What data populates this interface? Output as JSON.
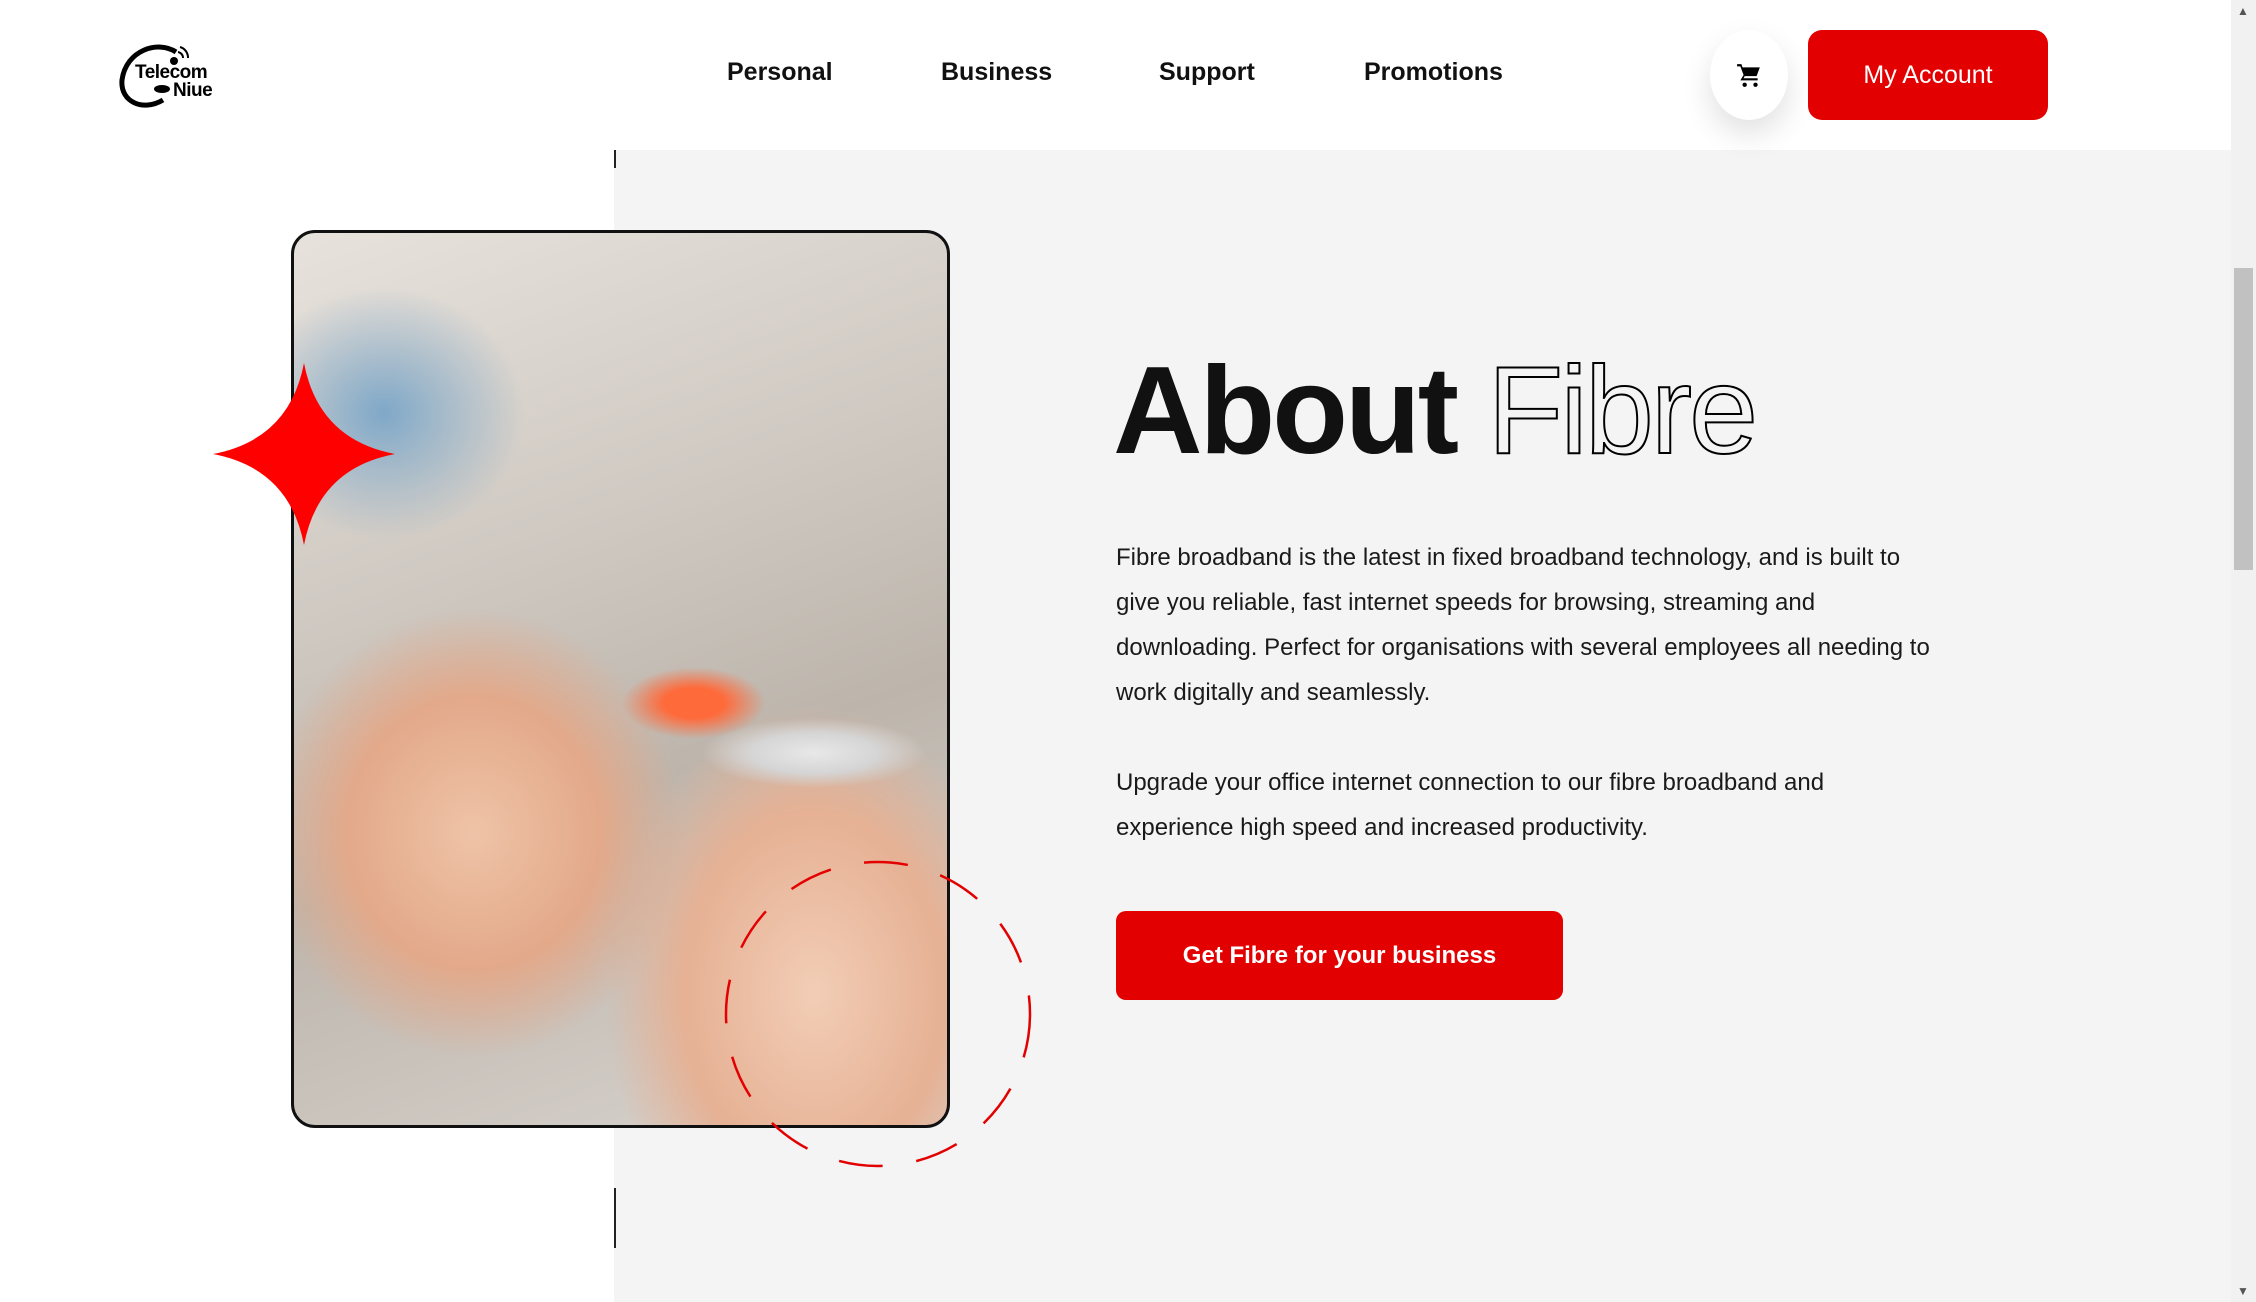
{
  "header": {
    "logo_text": [
      "Telecom",
      "Niue"
    ],
    "nav": [
      "Personal",
      "Business",
      "Support",
      "Promotions"
    ],
    "cart_icon": "cart-icon",
    "account_label": "My Account"
  },
  "hero": {
    "title_bold": "About",
    "title_outline": "Fibre",
    "paragraphs": [
      "Fibre broadband is the latest in fixed broadband technology, and is built to give you reliable, fast internet speeds for browsing, streaming and downloading. Perfect for organisations with several employees all needing to work digitally and seamlessly.",
      "Upgrade your office internet connection to our fibre broadband and experience high speed and increased productivity."
    ],
    "cta_label": "Get Fibre for your business"
  },
  "colors": {
    "accent": "#e30000",
    "section_bg": "#f4f4f4"
  }
}
